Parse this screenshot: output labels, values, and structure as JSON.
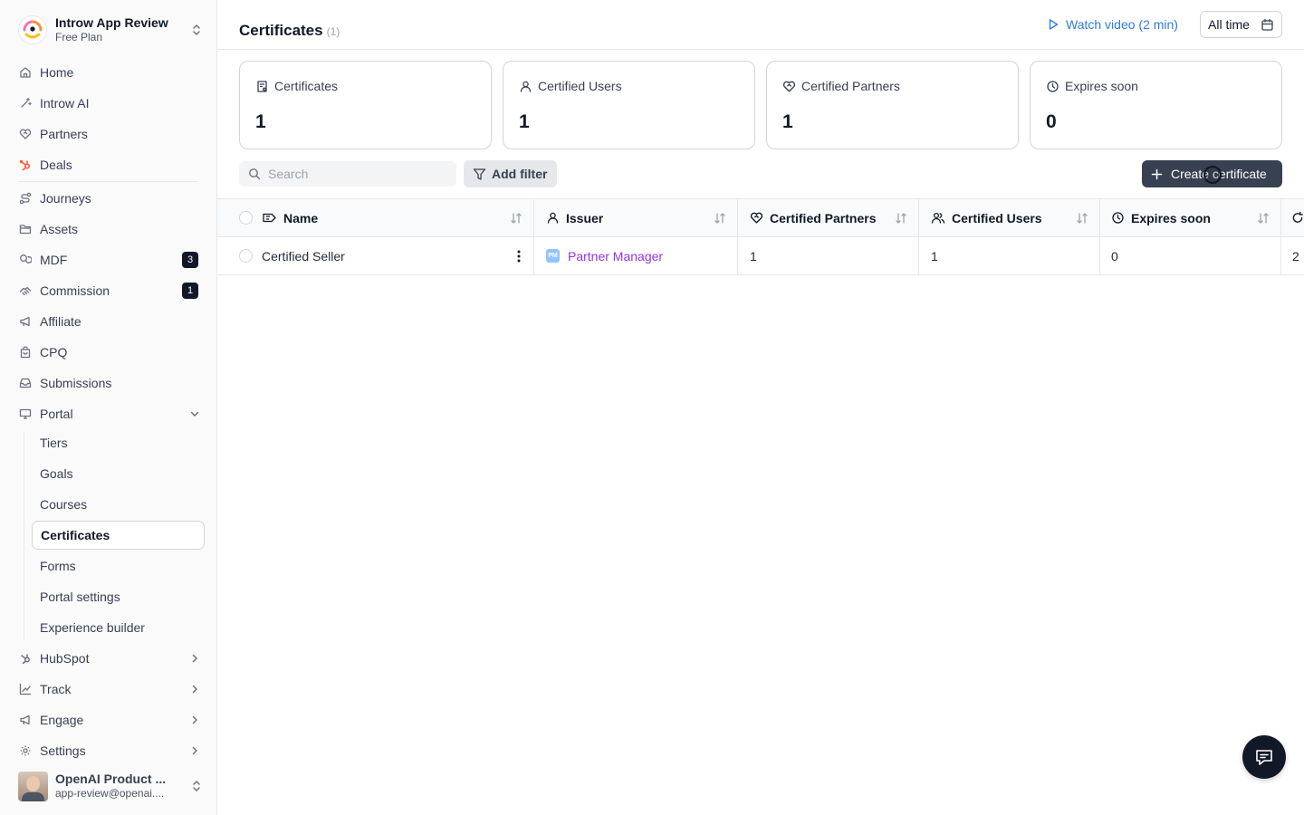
{
  "workspace": {
    "name": "Introw App Review",
    "plan": "Free Plan"
  },
  "sidebar": {
    "items": [
      {
        "label": "Home"
      },
      {
        "label": "Introw AI"
      },
      {
        "label": "Partners"
      },
      {
        "label": "Deals"
      },
      {
        "label": "Journeys"
      },
      {
        "label": "Assets"
      },
      {
        "label": "MDF",
        "badge": "3"
      },
      {
        "label": "Commission",
        "badge": "1"
      },
      {
        "label": "Affiliate"
      },
      {
        "label": "CPQ"
      },
      {
        "label": "Submissions"
      },
      {
        "label": "Portal"
      }
    ],
    "portal_sub": [
      {
        "label": "Tiers"
      },
      {
        "label": "Goals"
      },
      {
        "label": "Courses"
      },
      {
        "label": "Certificates"
      },
      {
        "label": "Forms"
      },
      {
        "label": "Portal settings"
      },
      {
        "label": "Experience builder"
      }
    ],
    "bottom_items": [
      {
        "label": "HubSpot"
      },
      {
        "label": "Track"
      },
      {
        "label": "Engage"
      },
      {
        "label": "Settings"
      }
    ]
  },
  "user": {
    "name": "OpenAI Product ...",
    "email": "app-review@openai...."
  },
  "header": {
    "title": "Certificates",
    "count": "(1)",
    "watch_label": "Watch video (2 min)",
    "date_range": "All time"
  },
  "stats": [
    {
      "label": "Certificates",
      "value": "1"
    },
    {
      "label": "Certified Users",
      "value": "1"
    },
    {
      "label": "Certified Partners",
      "value": "1"
    },
    {
      "label": "Expires soon",
      "value": "0"
    }
  ],
  "toolbar": {
    "search_placeholder": "Search",
    "filter_label": "Add filter",
    "create_label": "Create certificate"
  },
  "table": {
    "columns": [
      "Name",
      "Issuer",
      "Certified Partners",
      "Certified Users",
      "Expires soon"
    ],
    "rows": [
      {
        "name": "Certified Seller",
        "issuer": "Partner Manager",
        "issuer_initials": "PM",
        "certified_partners": "1",
        "certified_users": "1",
        "expires_soon": "0",
        "extra": "2"
      }
    ]
  },
  "colors": {
    "accent": "#2e7ce0",
    "link": "#9333ea",
    "primary_button": "#374151",
    "hubspot": "#ff5c35"
  }
}
